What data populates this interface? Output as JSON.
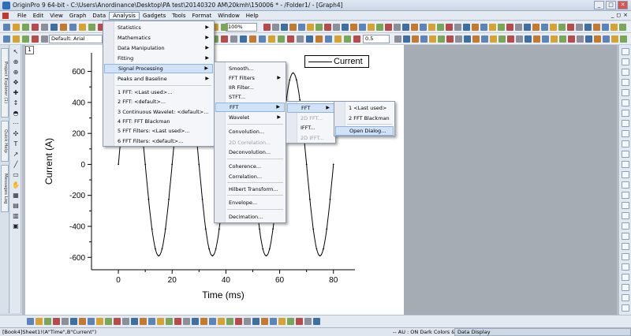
{
  "window": {
    "title": "OriginPro 9 64-bit - C:\\Users\\Anordinance\\Desktop\\PA test\\20140320 AM\\20kmh\\150006 * - /Folder1/ - [Graph4]",
    "min": "_",
    "max": "□",
    "close": "✕"
  },
  "menubar": {
    "items": [
      "File",
      "Edit",
      "View",
      "Graph",
      "Data",
      "Analysis",
      "Gadgets",
      "Tools",
      "Format",
      "Window",
      "Help"
    ],
    "active": "Analysis",
    "mdi_min": "_",
    "mdi_restore": "◻",
    "mdi_close": "×"
  },
  "toolbar": {
    "zoom": "100%",
    "font": "Default: Arial",
    "line_width": "0.5"
  },
  "left_tabs": [
    "Project Explorer (1)",
    "Quick Help",
    "Messages Log"
  ],
  "layer_number": "1",
  "menus": {
    "analysis": [
      "Statistics",
      "Mathematics",
      "Data Manipulation",
      "Fitting",
      "Signal Processing",
      "Peaks and Baseline"
    ],
    "analysis_recent": [
      "1 FFT: <Last used>...",
      "2 FFT: <default>...",
      "3 Continuous Wavelet: <default>...",
      "4 FFT: FFT Blackman",
      "5 FFT Filters: <Last used>...",
      "6 FFT Filters: <default>..."
    ],
    "signal": [
      "Smooth...",
      "FFT Filters",
      "IIR Filter...",
      "STFT...",
      "FFT",
      "Wavelet",
      "Convolution...",
      "2D Correlation...",
      "Deconvolution...",
      "Coherence...",
      "Correlation...",
      "Hilbert Transform...",
      "Envelope...",
      "Decimation..."
    ],
    "fft": [
      "FFT",
      "2D FFT...",
      "IFFT...",
      "2D IFFT..."
    ],
    "fft_sub": [
      "1 <Last used>",
      "2 FFT Blackman",
      "Open Dialog..."
    ]
  },
  "chart_data": {
    "type": "line",
    "title": "",
    "xlabel": "Time (ms)",
    "ylabel": "Current (A)",
    "xlim": [
      -10,
      88
    ],
    "ylim": [
      -680,
      720
    ],
    "xticks": [
      0,
      20,
      40,
      60,
      80
    ],
    "yticks": [
      -600,
      -400,
      -200,
      0,
      200,
      400,
      600
    ],
    "grid": false,
    "legend": "top-right",
    "series": [
      {
        "name": "Current",
        "color": "#000000",
        "amplitude": 590,
        "period_ms": 20,
        "phase": "sine",
        "x_start": 0,
        "x_end": 80,
        "marker": "dot"
      }
    ]
  },
  "status": {
    "left": "[Book4]Sheet1!(A\"Time\",B\"Current\")",
    "right": "-- AU : ON  Dark Colors &",
    "panel": "Data Display"
  }
}
